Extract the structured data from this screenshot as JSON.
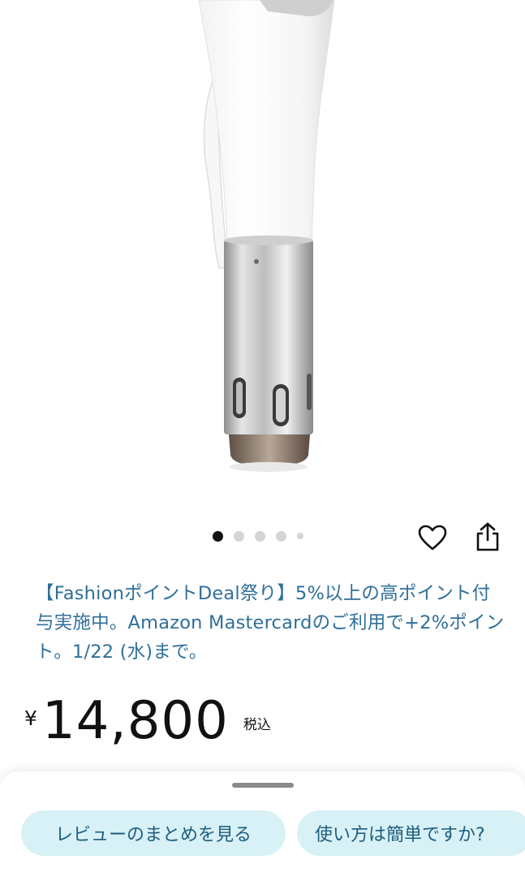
{
  "product": {
    "image_alt": "sous vide cooker",
    "carousel": {
      "total": 5,
      "active_index": 0
    }
  },
  "actions": {
    "wishlist_icon": "heart-outline-icon",
    "share_icon": "share-icon"
  },
  "promo": {
    "text": "【FashionポイントDeal祭り】5%以上の高ポイント付与実施中。Amazon Mastercardのご利用で+2%ポイント。1/22 (水)まで。"
  },
  "price": {
    "currency": "¥",
    "value": "14,800",
    "tax_label": "税込"
  },
  "bottom_sheet": {
    "chips": [
      {
        "label": "レビューのまとめを見る"
      },
      {
        "label": "使い方は簡単ですか?"
      }
    ]
  },
  "colors": {
    "link": "#2f6f99",
    "chip_bg": "#d7f1f6",
    "chip_text": "#1d5e7e"
  }
}
